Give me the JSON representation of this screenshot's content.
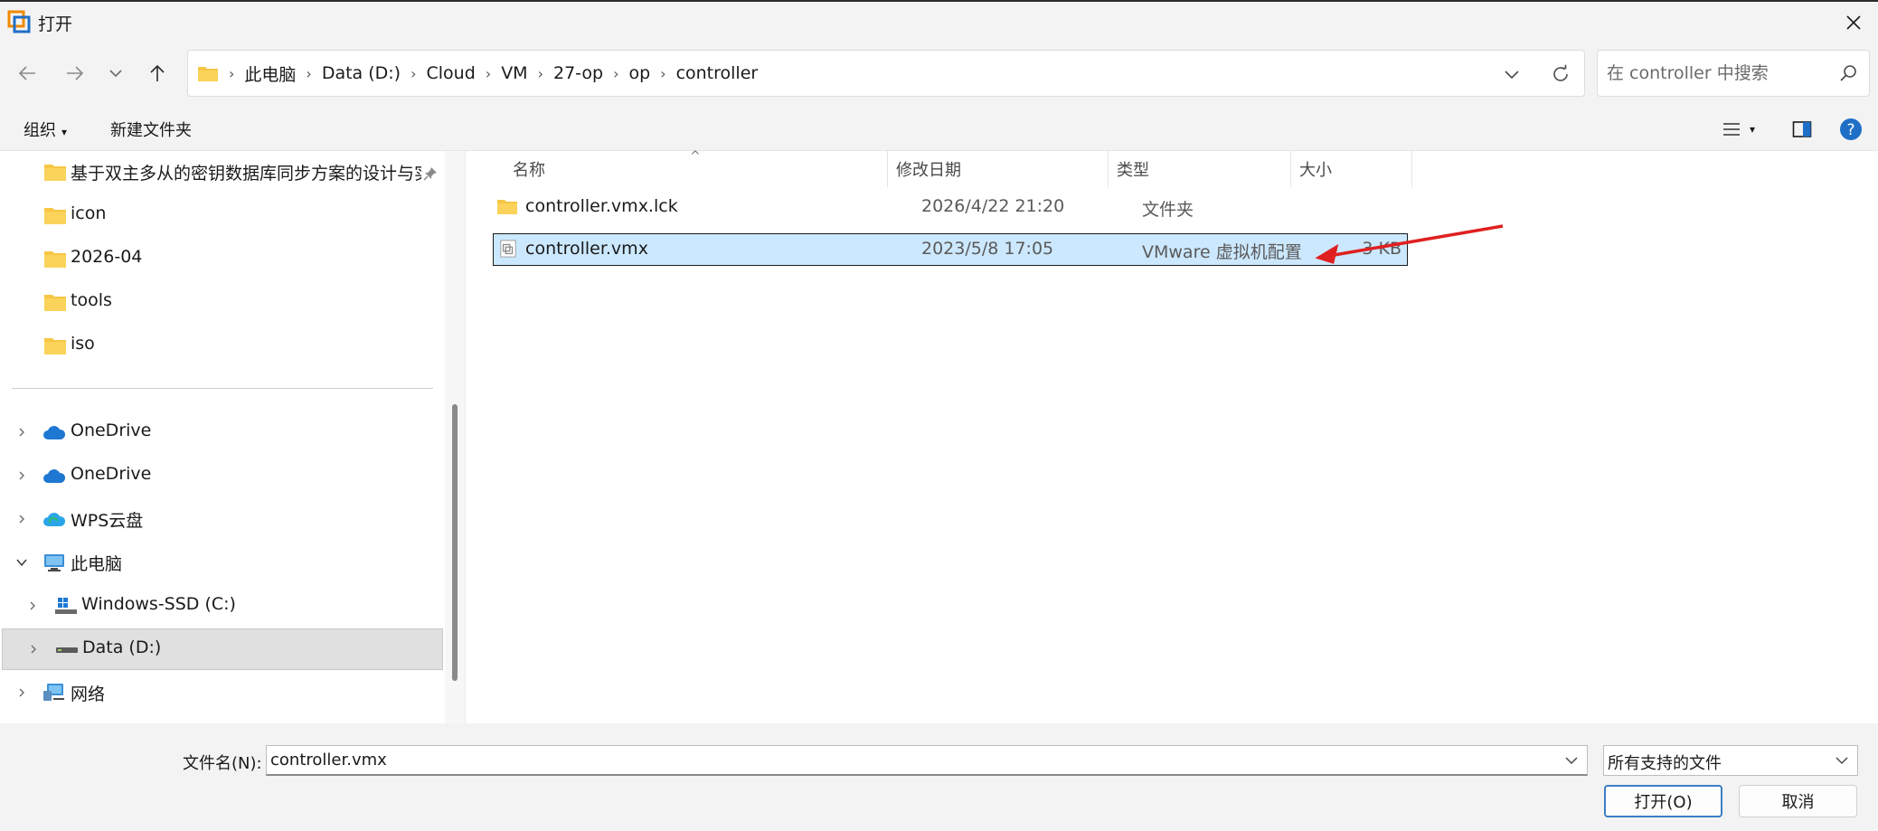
{
  "window": {
    "title": "打开"
  },
  "address": {
    "crumbs": [
      "此电脑",
      "Data (D:)",
      "Cloud",
      "VM",
      "27-op",
      "op",
      "controller"
    ]
  },
  "search": {
    "placeholder": "在 controller 中搜索"
  },
  "toolbar": {
    "organize": "组织",
    "new_folder": "新建文件夹"
  },
  "sidebar": {
    "pinned": [
      {
        "label": "基于双主多从的密钥数据库同步方案的设计与实现"
      },
      {
        "label": "icon"
      },
      {
        "label": "2026-04"
      },
      {
        "label": "tools"
      },
      {
        "label": "iso"
      }
    ],
    "tree": [
      {
        "label": "OneDrive"
      },
      {
        "label": "OneDrive"
      },
      {
        "label": "WPS云盘"
      },
      {
        "label": "此电脑"
      },
      {
        "label": "Windows-SSD (C:)"
      },
      {
        "label": "Data (D:)"
      },
      {
        "label": "网络"
      }
    ]
  },
  "columns": {
    "name": "名称",
    "date": "修改日期",
    "type": "类型",
    "size": "大小"
  },
  "files": [
    {
      "name": "controller.vmx.lck",
      "date": "2026/4/22 21:20",
      "type": "文件夹",
      "size": ""
    },
    {
      "name": "controller.vmx",
      "date": "2023/5/8 17:05",
      "type": "VMware 虚拟机配置",
      "size": "3 KB"
    }
  ],
  "footer": {
    "filename_label": "文件名(N):",
    "filename_value": "controller.vmx",
    "filetype": "所有支持的文件",
    "open_button": "打开(O)",
    "cancel_button": "取消"
  },
  "colors": {
    "selection": "#cce8ff",
    "accent": "#3c7fc4",
    "annotation": "#e02020"
  }
}
